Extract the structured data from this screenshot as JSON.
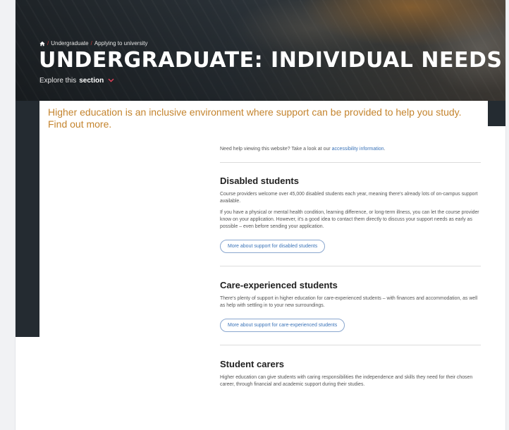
{
  "breadcrumb": {
    "items": [
      "Undergraduate",
      "Applying to university"
    ],
    "separator": "/"
  },
  "hero": {
    "title": "UNDERGRADUATE: INDIVIDUAL NEEDS",
    "explore_prefix": "Explore this",
    "explore_bold": "section"
  },
  "intro": {
    "text": "Higher education is an inclusive environment where support can be provided to help you study. Find out more."
  },
  "help": {
    "text": "Need help viewing this website? Take a look at our ",
    "link": "accessibility information",
    "suffix": "."
  },
  "sections": [
    {
      "title": "Disabled students",
      "paragraphs": [
        "Course providers welcome over 45,000 disabled students each year, meaning there's already lots of on-campus support available.",
        "If you have a physical or mental health condition, learning difference, or long-term illness, you can let the course provider know on your application. However, it's a good idea to contact them directly to discuss your support needs as early as possible – even before sending your application."
      ],
      "button": "More about support for disabled students"
    },
    {
      "title": "Care-experienced students",
      "paragraphs": [
        "There's plenty of support in higher education for care-experienced students – with finances and accommodation, as well as help with settling in to your new surroundings."
      ],
      "button": "More about support for care-experienced students"
    },
    {
      "title": "Student carers",
      "paragraphs": [
        "Higher education can give students with caring responsibilities the independence and skills they need for their chosen career, through financial and academic support during their studies."
      ]
    }
  ],
  "colors": {
    "accent": "#c4842e",
    "link": "#3a73b8",
    "chevron": "#e1415a",
    "dark_band": "#242b31"
  },
  "icons": {
    "home": "home-icon",
    "explore_chevron": "chevron-down-icon"
  }
}
